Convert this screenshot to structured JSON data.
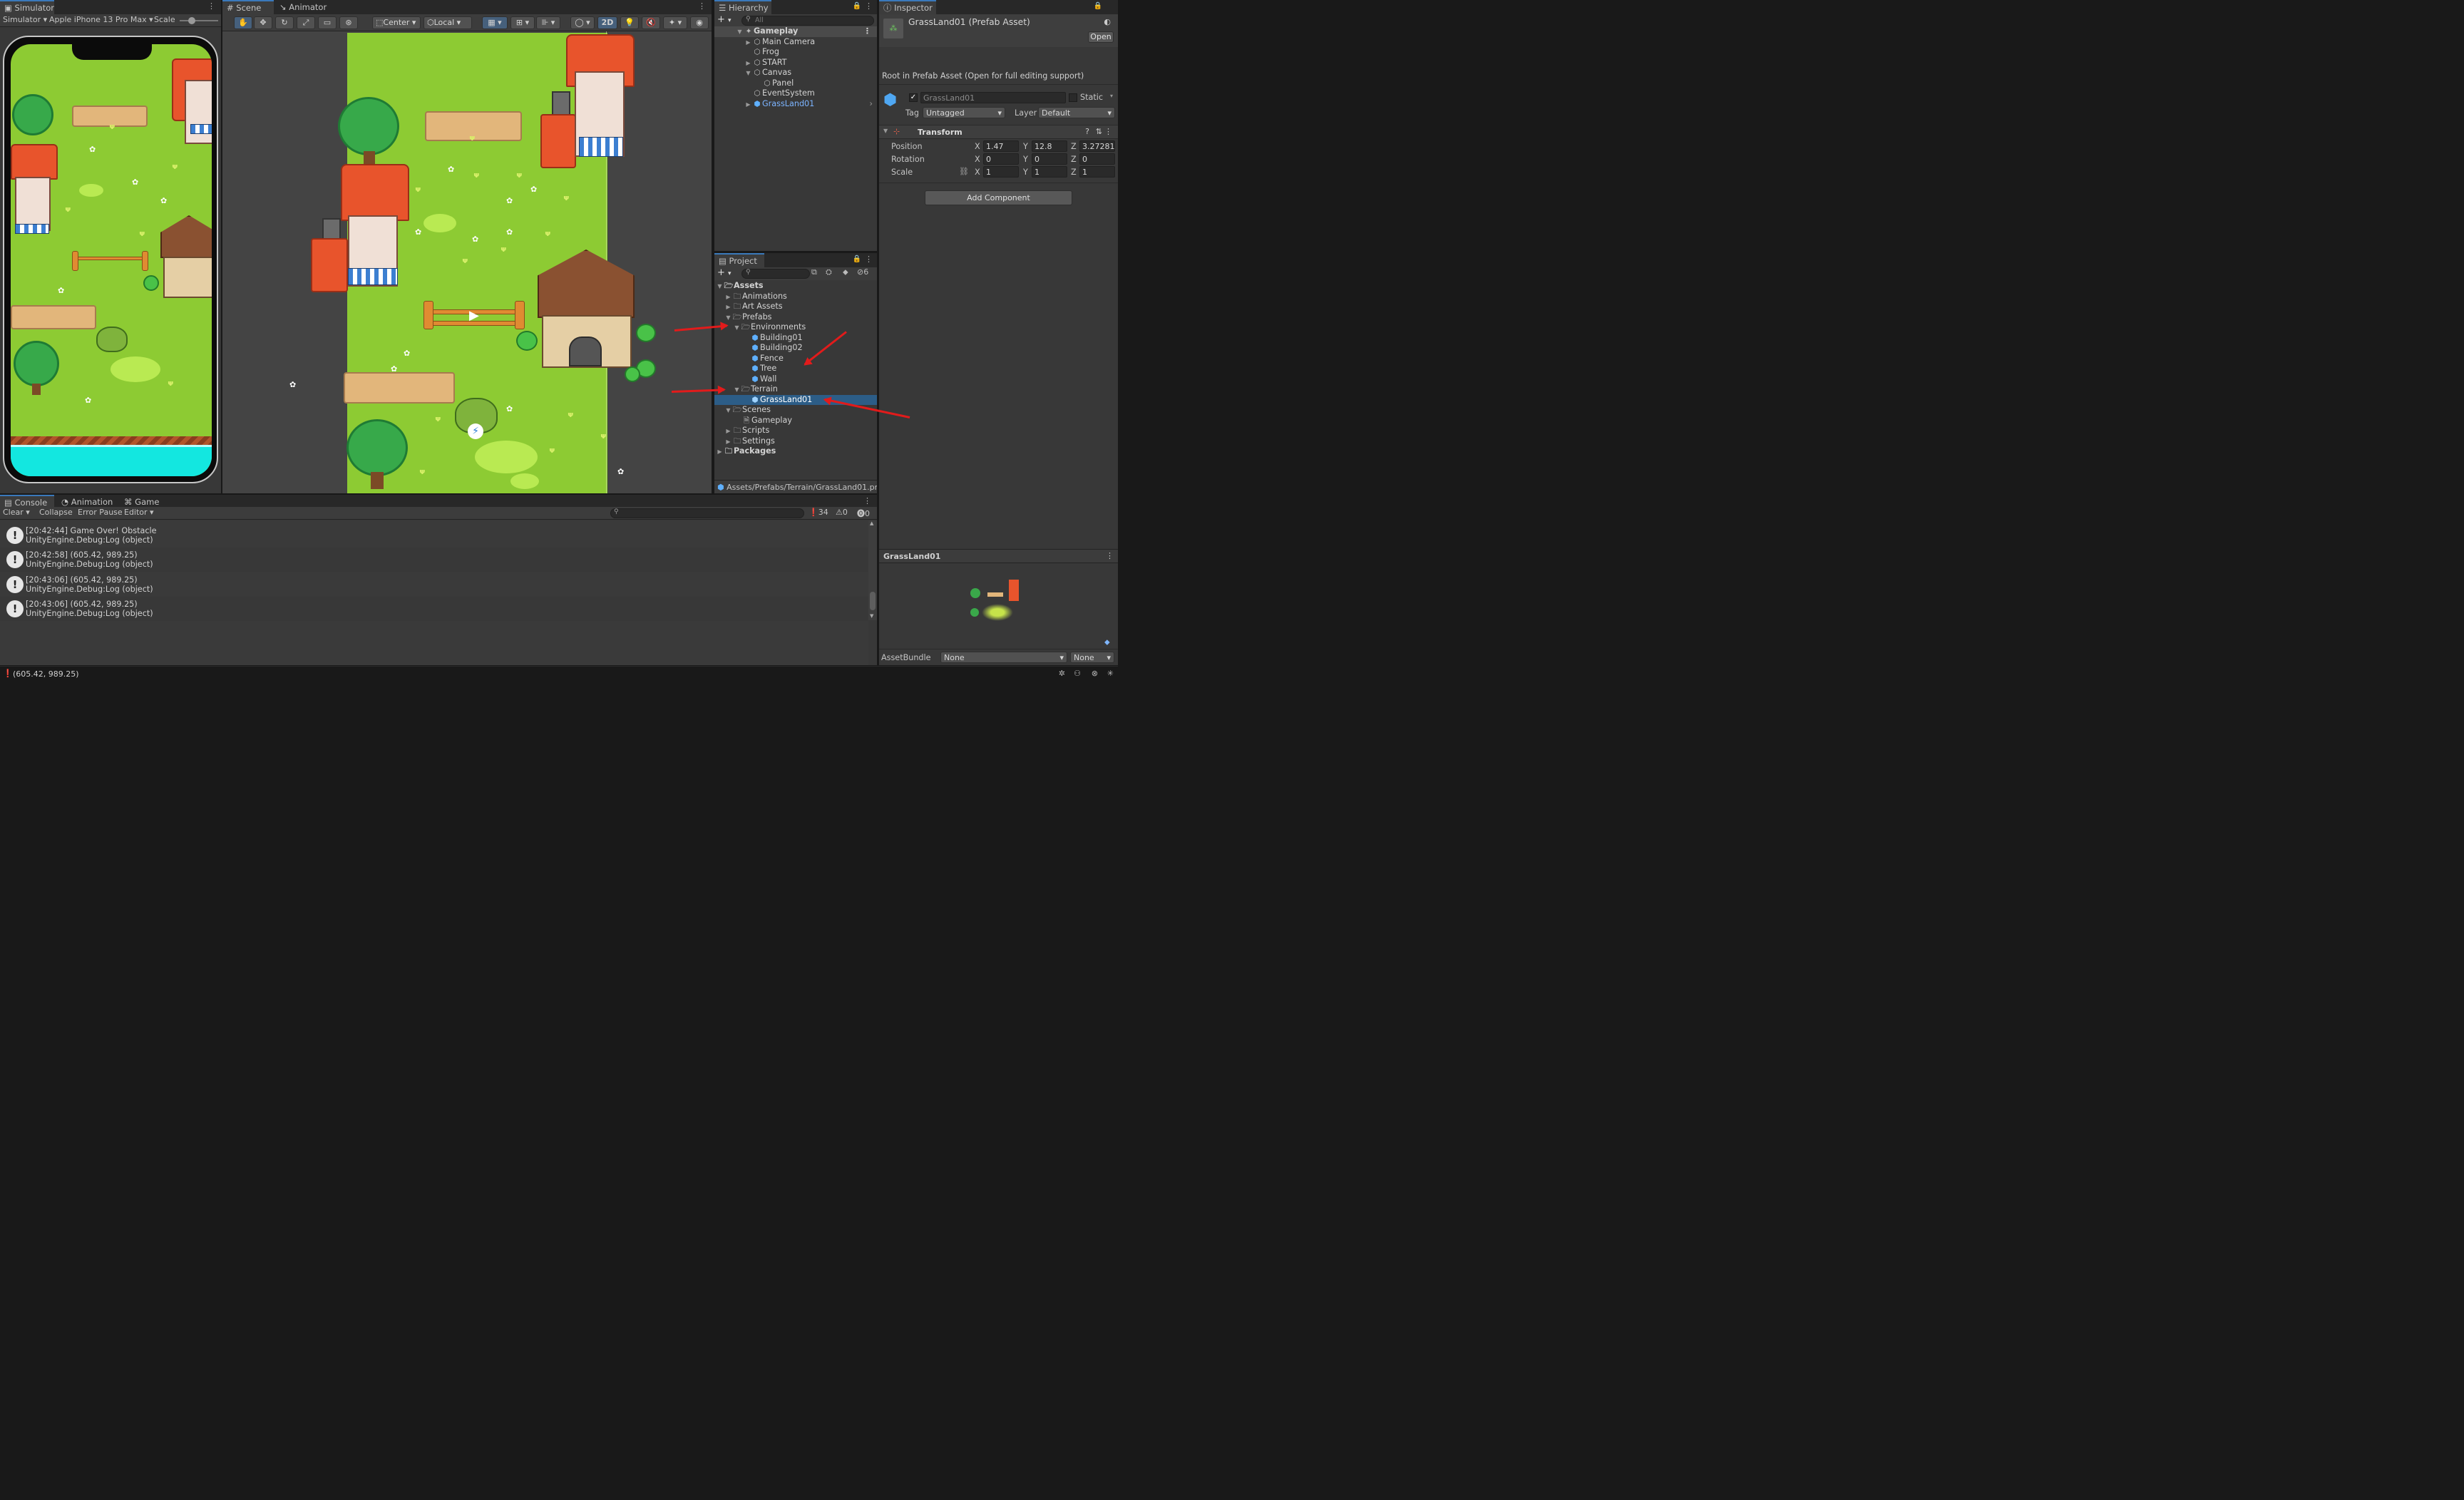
{
  "simulator": {
    "tab": "Simulator",
    "mode": "Simulator",
    "device": "Apple iPhone 13 Pro Max",
    "scale_label": "Scale"
  },
  "scene": {
    "tabs": [
      "Scene",
      "Animator"
    ],
    "pivot": "Center",
    "space": "Local",
    "mode_2d": "2D"
  },
  "hierarchy": {
    "tab": "Hierarchy",
    "search_placeholder": "All",
    "root": "Gameplay",
    "items": [
      "Main Camera",
      "Frog",
      "START",
      "Canvas",
      "Panel",
      "EventSystem",
      "GrassLand01"
    ]
  },
  "project": {
    "tab": "Project",
    "hidden_count": "6",
    "root": "Assets",
    "items": [
      "Animations",
      "Art Assets",
      "Prefabs",
      "Environments",
      "Building01",
      "Building02",
      "Fence",
      "Tree",
      "Wall",
      "Terrain",
      "GrassLand01",
      "Scenes",
      "Gameplay",
      "Scripts",
      "Settings",
      "Packages"
    ],
    "path": "Assets/Prefabs/Terrain/GrassLand01.pre"
  },
  "inspector": {
    "tab": "Inspector",
    "title": "GrassLand01 (Prefab Asset)",
    "open_label": "Open",
    "root_note": "Root in Prefab Asset (Open for full editing support)",
    "name": "GrassLand01",
    "static_label": "Static",
    "tag_label": "Tag",
    "tag_value": "Untagged",
    "layer_label": "Layer",
    "layer_value": "Default",
    "transform_label": "Transform",
    "position_label": "Position",
    "rotation_label": "Rotation",
    "scale_label": "Scale",
    "position": {
      "x": "1.47",
      "y": "12.8",
      "z": "3.272815"
    },
    "rotation": {
      "x": "0",
      "y": "0",
      "z": "0"
    },
    "scale": {
      "x": "1",
      "y": "1",
      "z": "1"
    },
    "add_component": "Add Component",
    "preview_title": "GrassLand01",
    "assetbundle_label": "AssetBundle",
    "assetbundle_value": "None",
    "assetbundle_variant": "None"
  },
  "console": {
    "tabs": [
      "Console",
      "Animation",
      "Game"
    ],
    "buttons": [
      "Clear",
      "Collapse",
      "Error Pause",
      "Editor"
    ],
    "counts": {
      "log": "34",
      "warn": "0",
      "error": "0"
    },
    "logs": [
      {
        "line1": "[20:42:44] Game Over! Obstacle",
        "line2": "UnityEngine.Debug:Log (object)"
      },
      {
        "line1": "[20:42:58] (605.42, 989.25)",
        "line2": "UnityEngine.Debug:Log (object)"
      },
      {
        "line1": "[20:43:06] (605.42, 989.25)",
        "line2": "UnityEngine.Debug:Log (object)"
      },
      {
        "line1": "[20:43:06] (605.42, 989.25)",
        "line2": "UnityEngine.Debug:Log (object)"
      }
    ]
  },
  "status_bar": {
    "message": "(605.42, 989.25)"
  },
  "colors": {
    "accent": "#3a79bb",
    "selection": "#2c5d87",
    "grass": "#8dcb33",
    "annotation_arrow": "#e21b1b"
  }
}
